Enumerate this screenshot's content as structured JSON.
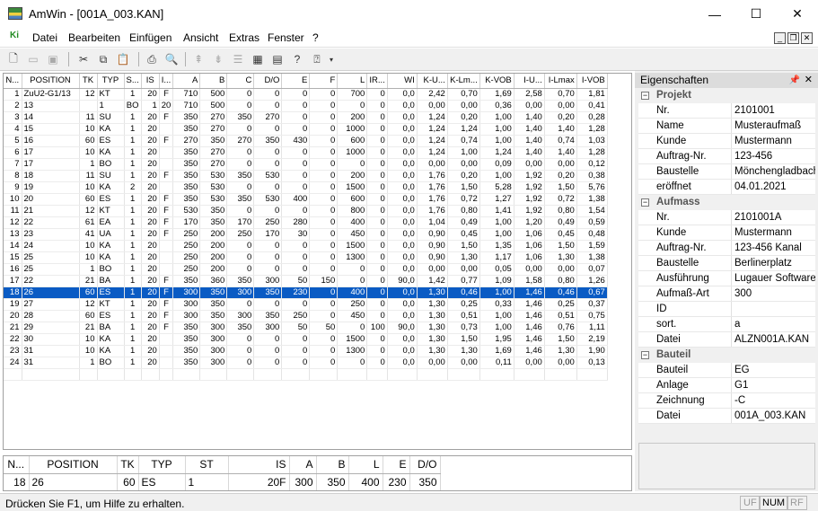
{
  "window": {
    "title": "AmWin - [001A_003.KAN]",
    "min": "—",
    "max": "☐",
    "close": "✕"
  },
  "menu": [
    "Datei",
    "Bearbeiten",
    "Einfügen",
    "Ansicht",
    "Extras",
    "Fenster",
    "?"
  ],
  "menu_icon": "Ki",
  "toolbar_icons": [
    "new-icon",
    "open-icon",
    "save-icon",
    "cut-icon",
    "copy-icon",
    "paste-icon",
    "print-icon",
    "print-preview-icon",
    "sort-asc-icon",
    "sort-desc-icon",
    "grid-lines-icon",
    "table-icon",
    "calendar-icon",
    "help-icon",
    "context-help-icon",
    "dropdown-icon"
  ],
  "grid": {
    "columns": [
      "N...",
      "POSITION",
      "TK",
      "TYP",
      "S...",
      "IS",
      "I...",
      "A",
      "B",
      "C",
      "D/O",
      "E",
      "F",
      "L",
      "IR...",
      "WI",
      "K-U...",
      "K-Lm...",
      "K-VOB",
      "I-U...",
      "I-Lmax",
      "I-VOB"
    ],
    "rows": [
      [
        "1",
        "ZuU2-G1/13",
        "12",
        "KT",
        "1",
        "20",
        "F",
        "710",
        "500",
        "0",
        "0",
        "0",
        "0",
        "700",
        "0",
        "0,0",
        "2,42",
        "0,70",
        "1,69",
        "2,58",
        "0,70",
        "1,81"
      ],
      [
        "2",
        "13",
        "",
        "1",
        "BO",
        "1",
        "20",
        "710",
        "500",
        "0",
        "0",
        "0",
        "0",
        "0",
        "0",
        "0,0",
        "0,00",
        "0,00",
        "0,36",
        "0,00",
        "0,00",
        "0,41"
      ],
      [
        "3",
        "14",
        "11",
        "SU",
        "1",
        "20",
        "F",
        "350",
        "270",
        "350",
        "270",
        "0",
        "0",
        "200",
        "0",
        "0,0",
        "1,24",
        "0,20",
        "1,00",
        "1,40",
        "0,20",
        "0,28"
      ],
      [
        "4",
        "15",
        "10",
        "KA",
        "1",
        "20",
        "",
        "350",
        "270",
        "0",
        "0",
        "0",
        "0",
        "1000",
        "0",
        "0,0",
        "1,24",
        "1,24",
        "1,00",
        "1,40",
        "1,40",
        "1,28"
      ],
      [
        "5",
        "16",
        "60",
        "ES",
        "1",
        "20",
        "F",
        "270",
        "350",
        "270",
        "350",
        "430",
        "0",
        "600",
        "0",
        "0,0",
        "1,24",
        "0,74",
        "1,00",
        "1,40",
        "0,74",
        "1,03"
      ],
      [
        "6",
        "17",
        "10",
        "KA",
        "1",
        "20",
        "",
        "350",
        "270",
        "0",
        "0",
        "0",
        "0",
        "1000",
        "0",
        "0,0",
        "1,24",
        "1,00",
        "1,24",
        "1,40",
        "1,40",
        "1,28"
      ],
      [
        "7",
        "17",
        "1",
        "BO",
        "1",
        "20",
        "",
        "350",
        "270",
        "0",
        "0",
        "0",
        "0",
        "0",
        "0",
        "0,0",
        "0,00",
        "0,00",
        "0,09",
        "0,00",
        "0,00",
        "0,12"
      ],
      [
        "8",
        "18",
        "11",
        "SU",
        "1",
        "20",
        "F",
        "350",
        "530",
        "350",
        "530",
        "0",
        "0",
        "200",
        "0",
        "0,0",
        "1,76",
        "0,20",
        "1,00",
        "1,92",
        "0,20",
        "0,38"
      ],
      [
        "9",
        "19",
        "10",
        "KA",
        "2",
        "20",
        "",
        "350",
        "530",
        "0",
        "0",
        "0",
        "0",
        "1500",
        "0",
        "0,0",
        "1,76",
        "1,50",
        "5,28",
        "1,92",
        "1,50",
        "5,76"
      ],
      [
        "10",
        "20",
        "60",
        "ES",
        "1",
        "20",
        "F",
        "350",
        "530",
        "350",
        "530",
        "400",
        "0",
        "600",
        "0",
        "0,0",
        "1,76",
        "0,72",
        "1,27",
        "1,92",
        "0,72",
        "1,38"
      ],
      [
        "11",
        "21",
        "12",
        "KT",
        "1",
        "20",
        "F",
        "530",
        "350",
        "0",
        "0",
        "0",
        "0",
        "800",
        "0",
        "0,0",
        "1,76",
        "0,80",
        "1,41",
        "1,92",
        "0,80",
        "1,54"
      ],
      [
        "12",
        "22",
        "61",
        "EA",
        "1",
        "20",
        "F",
        "170",
        "350",
        "170",
        "250",
        "280",
        "0",
        "400",
        "0",
        "0,0",
        "1,04",
        "0,49",
        "1,00",
        "1,20",
        "0,49",
        "0,59"
      ],
      [
        "13",
        "23",
        "41",
        "UA",
        "1",
        "20",
        "F",
        "250",
        "200",
        "250",
        "170",
        "30",
        "0",
        "450",
        "0",
        "0,0",
        "0,90",
        "0,45",
        "1,00",
        "1,06",
        "0,45",
        "0,48"
      ],
      [
        "14",
        "24",
        "10",
        "KA",
        "1",
        "20",
        "",
        "250",
        "200",
        "0",
        "0",
        "0",
        "0",
        "1500",
        "0",
        "0,0",
        "0,90",
        "1,50",
        "1,35",
        "1,06",
        "1,50",
        "1,59"
      ],
      [
        "15",
        "25",
        "10",
        "KA",
        "1",
        "20",
        "",
        "250",
        "200",
        "0",
        "0",
        "0",
        "0",
        "1300",
        "0",
        "0,0",
        "0,90",
        "1,30",
        "1,17",
        "1,06",
        "1,30",
        "1,38"
      ],
      [
        "16",
        "25",
        "1",
        "BO",
        "1",
        "20",
        "",
        "250",
        "200",
        "0",
        "0",
        "0",
        "0",
        "0",
        "0",
        "0,0",
        "0,00",
        "0,00",
        "0,05",
        "0,00",
        "0,00",
        "0,07"
      ],
      [
        "17",
        "22",
        "21",
        "BA",
        "1",
        "20",
        "F",
        "350",
        "360",
        "350",
        "300",
        "50",
        "150",
        "0",
        "0",
        "90,0",
        "1,42",
        "0,77",
        "1,09",
        "1,58",
        "0,80",
        "1,26"
      ],
      [
        "18",
        "26",
        "60",
        "ES",
        "1",
        "20",
        "F",
        "300",
        "350",
        "300",
        "350",
        "230",
        "0",
        "400",
        "0",
        "0,0",
        "1,30",
        "0,46",
        "1,00",
        "1,46",
        "0,46",
        "0,67"
      ],
      [
        "19",
        "27",
        "12",
        "KT",
        "1",
        "20",
        "F",
        "300",
        "350",
        "0",
        "0",
        "0",
        "0",
        "250",
        "0",
        "0,0",
        "1,30",
        "0,25",
        "0,33",
        "1,46",
        "0,25",
        "0,37"
      ],
      [
        "20",
        "28",
        "60",
        "ES",
        "1",
        "20",
        "F",
        "300",
        "350",
        "300",
        "350",
        "250",
        "0",
        "450",
        "0",
        "0,0",
        "1,30",
        "0,51",
        "1,00",
        "1,46",
        "0,51",
        "0,75"
      ],
      [
        "21",
        "29",
        "21",
        "BA",
        "1",
        "20",
        "F",
        "350",
        "300",
        "350",
        "300",
        "50",
        "50",
        "0",
        "100",
        "90,0",
        "1,30",
        "0,73",
        "1,00",
        "1,46",
        "0,76",
        "1,11"
      ],
      [
        "22",
        "30",
        "10",
        "KA",
        "1",
        "20",
        "",
        "350",
        "300",
        "0",
        "0",
        "0",
        "0",
        "1500",
        "0",
        "0,0",
        "1,30",
        "1,50",
        "1,95",
        "1,46",
        "1,50",
        "2,19"
      ],
      [
        "23",
        "31",
        "10",
        "KA",
        "1",
        "20",
        "",
        "350",
        "300",
        "0",
        "0",
        "0",
        "0",
        "1300",
        "0",
        "0,0",
        "1,30",
        "1,30",
        "1,69",
        "1,46",
        "1,30",
        "1,90"
      ],
      [
        "24",
        "31",
        "1",
        "BO",
        "1",
        "20",
        "",
        "350",
        "300",
        "0",
        "0",
        "0",
        "0",
        "0",
        "0",
        "0,0",
        "0,00",
        "0,00",
        "0,11",
        "0,00",
        "0,00",
        "0,13"
      ]
    ],
    "selected_row": 17
  },
  "properties": {
    "title": "Eigenschaften",
    "groups": [
      {
        "name": "Projekt",
        "rows": [
          [
            "Nr.",
            "2101001"
          ],
          [
            "Name",
            "Musteraufmaß"
          ],
          [
            "Kunde",
            "Mustermann"
          ],
          [
            "Auftrag-Nr.",
            "123-456"
          ],
          [
            "Baustelle",
            "Mönchengladbach"
          ],
          [
            "eröffnet",
            "04.01.2021"
          ]
        ]
      },
      {
        "name": "Aufmass",
        "rows": [
          [
            "Nr.",
            "2101001A"
          ],
          [
            "Kunde",
            "Mustermann"
          ],
          [
            "Auftrag-Nr.",
            "123-456 Kanal"
          ],
          [
            "Baustelle",
            "Berlinerplatz"
          ],
          [
            "Ausführung",
            "Lugauer Software"
          ],
          [
            "Aufmaß-Art",
            "300"
          ],
          [
            "ID",
            ""
          ],
          [
            "sort.",
            "a"
          ],
          [
            "Datei",
            "ALZN001A.KAN"
          ]
        ]
      },
      {
        "name": "Bauteil",
        "rows": [
          [
            "Bauteil",
            "EG"
          ],
          [
            "Anlage",
            "G1"
          ],
          [
            "Zeichnung",
            "-C"
          ],
          [
            "Datei",
            "001A_003.KAN"
          ]
        ]
      }
    ]
  },
  "detail": {
    "columns": [
      "N...",
      "POSITION",
      "TK",
      "TYP",
      "ST",
      "IS",
      "A",
      "B",
      "L",
      "E",
      "D/O"
    ],
    "values": [
      "18",
      "26",
      "60",
      "ES",
      "1",
      "20F",
      "300",
      "350",
      "400",
      "230",
      "350"
    ]
  },
  "status": {
    "text": "Drücken Sie F1, um Hilfe zu erhalten.",
    "indicators": [
      "UF",
      "NUM",
      "RF"
    ]
  }
}
